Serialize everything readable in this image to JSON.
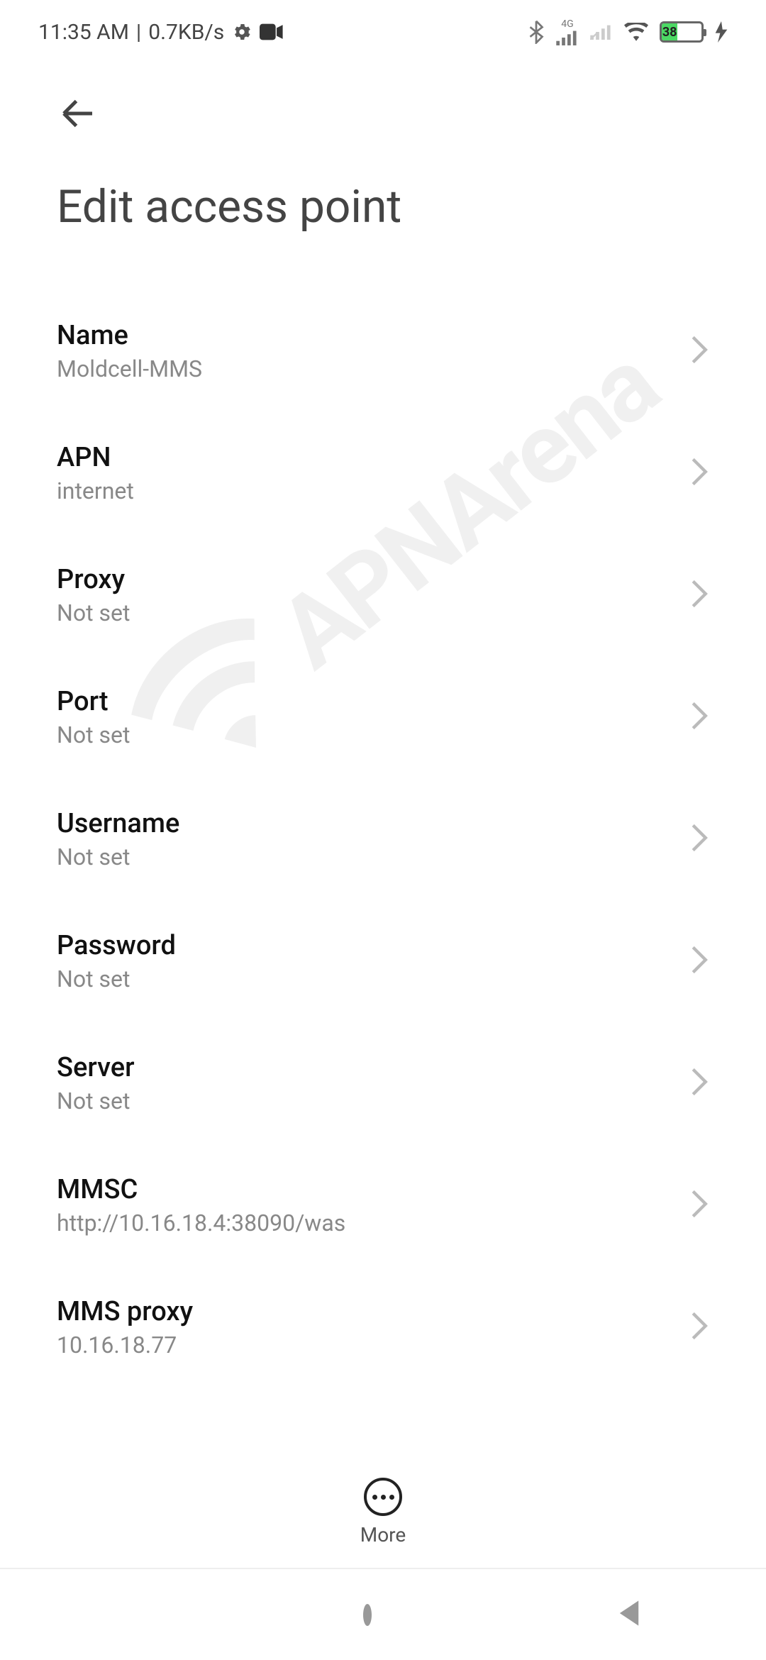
{
  "statusbar": {
    "time": "11:35 AM",
    "data_rate": "0.7KB/s",
    "network_label": "4G",
    "battery_pct": "38"
  },
  "header": {
    "title": "Edit access point"
  },
  "settings": [
    {
      "label": "Name",
      "value": "Moldcell-MMS"
    },
    {
      "label": "APN",
      "value": "internet"
    },
    {
      "label": "Proxy",
      "value": "Not set"
    },
    {
      "label": "Port",
      "value": "Not set"
    },
    {
      "label": "Username",
      "value": "Not set"
    },
    {
      "label": "Password",
      "value": "Not set"
    },
    {
      "label": "Server",
      "value": "Not set"
    },
    {
      "label": "MMSC",
      "value": "http://10.16.18.4:38090/was"
    },
    {
      "label": "MMS proxy",
      "value": "10.16.18.77"
    }
  ],
  "bottom": {
    "more_label": "More"
  },
  "watermark": {
    "text": "APNArena"
  }
}
